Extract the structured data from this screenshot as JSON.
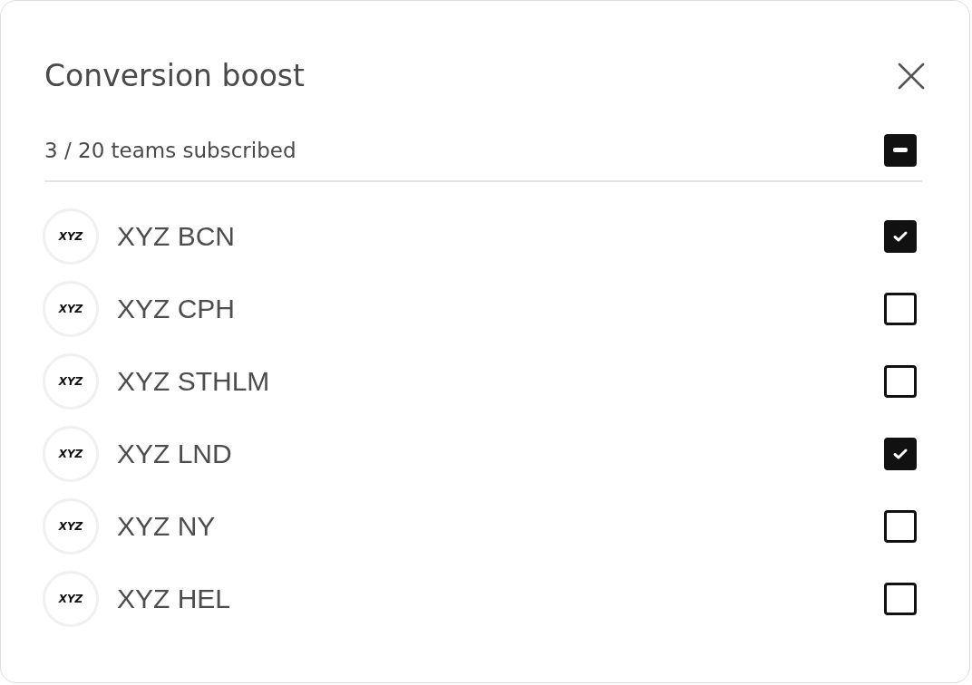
{
  "dialog": {
    "title": "Conversion boost"
  },
  "summary": {
    "text": "3 / 20 teams subscribed",
    "partly_selected": true
  },
  "teams": [
    {
      "logo": "XYZ",
      "name": "XYZ BCN",
      "checked": true
    },
    {
      "logo": "XYZ",
      "name": "XYZ CPH",
      "checked": false
    },
    {
      "logo": "XYZ",
      "name": "XYZ STHLM",
      "checked": false
    },
    {
      "logo": "XYZ",
      "name": "XYZ LND",
      "checked": true
    },
    {
      "logo": "XYZ",
      "name": "XYZ NY",
      "checked": false
    },
    {
      "logo": "XYZ",
      "name": "XYZ HEL",
      "checked": false
    }
  ]
}
